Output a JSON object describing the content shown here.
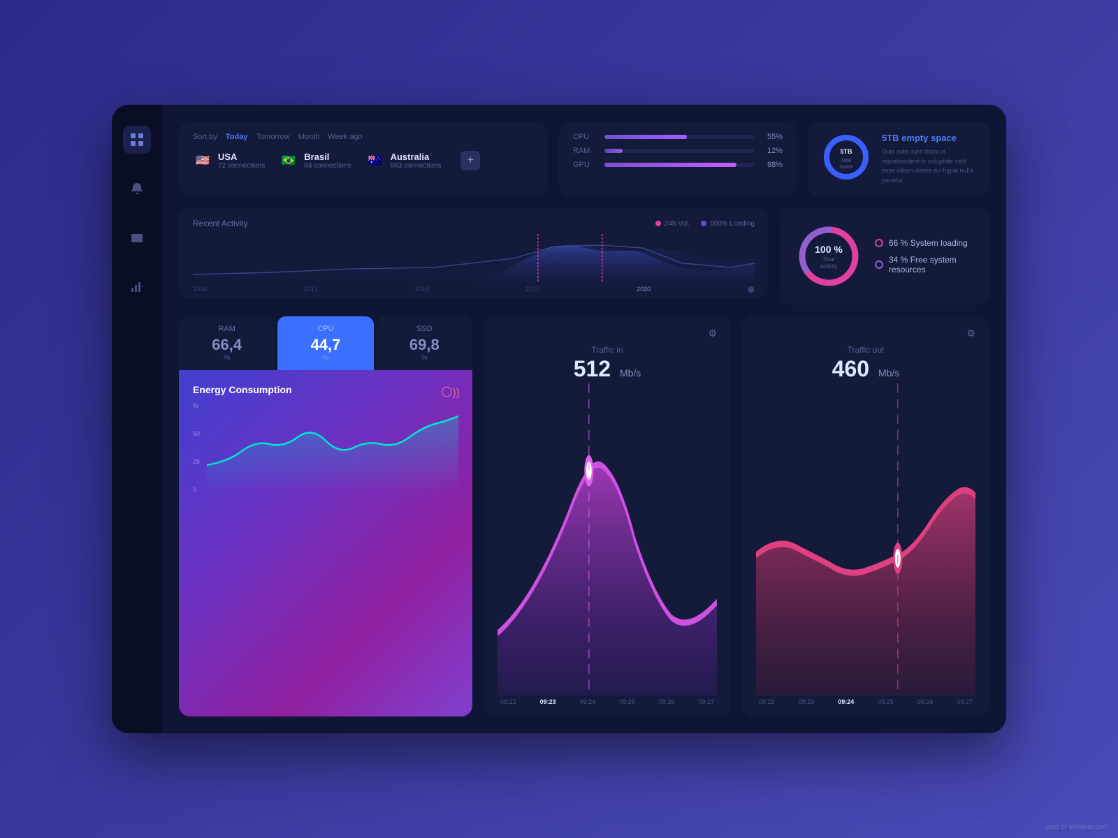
{
  "sidebar": {
    "icons": [
      "grid-icon",
      "bell-icon",
      "wallet-icon",
      "chart-icon"
    ]
  },
  "sortBar": {
    "label": "Sort by",
    "items": [
      "Today",
      "Tomorrow",
      "Month",
      "Week ago"
    ],
    "active": "Today"
  },
  "countries": [
    {
      "flag": "🇺🇸",
      "name": "USA",
      "connections": "72 connections"
    },
    {
      "flag": "🇧🇷",
      "name": "Brasil",
      "connections": "84 connections"
    },
    {
      "flag": "🇦🇺",
      "name": "Australia",
      "connections": "663 connections"
    }
  ],
  "metrics": [
    {
      "label": "CPU",
      "value": "55%",
      "pct": 55
    },
    {
      "label": "RAM",
      "value": "12%",
      "pct": 12
    },
    {
      "label": "GPU",
      "value": "88%",
      "pct": 88
    }
  ],
  "storage": {
    "amount": "5TB",
    "label": "Total Space",
    "title": "5TB empty space",
    "desc": "Duis aute irure dolor in reprehenderit in voluptate velit esse cillum dolore eu fugiat nulla pariatur."
  },
  "activity": {
    "title": "Recent Activity",
    "legend": [
      {
        "label": "24h Vol.",
        "color": "#e040a0"
      },
      {
        "label": "100% Loading",
        "color": "#6050d0"
      }
    ],
    "xLabels": [
      "2016",
      "2017",
      "2018",
      "2017",
      "2020",
      ""
    ]
  },
  "systemLoading": {
    "total": "100%",
    "totalLabel": "Total activity",
    "stats": [
      {
        "label": "66 %  System loading",
        "pct": 66,
        "color": "pink"
      },
      {
        "label": "34 %  Free system resources",
        "pct": 34,
        "color": "purple"
      }
    ]
  },
  "resources": {
    "tabs": [
      {
        "label": "RAM",
        "value": "66,4",
        "unit": "%"
      },
      {
        "label": "CPU",
        "value": "44,7",
        "unit": "%",
        "active": true
      },
      {
        "label": "SSD",
        "value": "69,8",
        "unit": "%"
      }
    ]
  },
  "energy": {
    "title": "Energy Consumption",
    "yLabels": [
      "%",
      "50",
      "25",
      "0"
    ]
  },
  "trafficIn": {
    "label": "Traffic in",
    "value": "512",
    "unit": "Mb/s",
    "xLabels": [
      "09:22",
      "09:23",
      "09:24",
      "09:25",
      "09:26",
      "09:27"
    ],
    "activeLabel": "09:23"
  },
  "trafficOut": {
    "label": "Traffic out",
    "value": "460",
    "unit": "Mb/s",
    "xLabels": [
      "09:22",
      "09:23",
      "09:24",
      "09:25",
      "09:26",
      "09:27"
    ],
    "activeLabel": "09:24"
  },
  "watermark": "post of uimaker.com"
}
